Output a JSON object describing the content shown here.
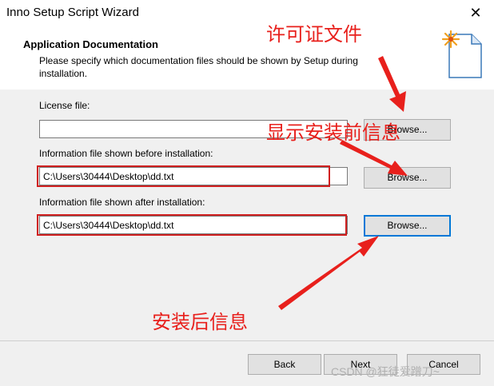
{
  "window": {
    "title": "Inno Setup Script Wizard",
    "close_glyph": "✕"
  },
  "header": {
    "title": "Application Documentation",
    "description": "Please specify which documentation files should be shown by Setup during installation.",
    "icon": "wizard-document-icon"
  },
  "fields": {
    "license": {
      "label": "License file:",
      "value": "",
      "browse": "Browse..."
    },
    "before": {
      "label": "Information file shown before installation:",
      "value": "C:\\Users\\30444\\Desktop\\dd.txt",
      "browse": "Browse..."
    },
    "after": {
      "label": "Information file shown after installation:",
      "value": "C:\\Users\\30444\\Desktop\\dd.txt",
      "browse": "Browse..."
    }
  },
  "annotations": {
    "license": "许可证文件",
    "before": "显示安装前信息",
    "after": "安装后信息",
    "color": "#e8201c"
  },
  "footer": {
    "back": "Back",
    "next": "Next",
    "cancel": "Cancel"
  },
  "watermark": "CSDN @狂徒爱蹭刀~"
}
